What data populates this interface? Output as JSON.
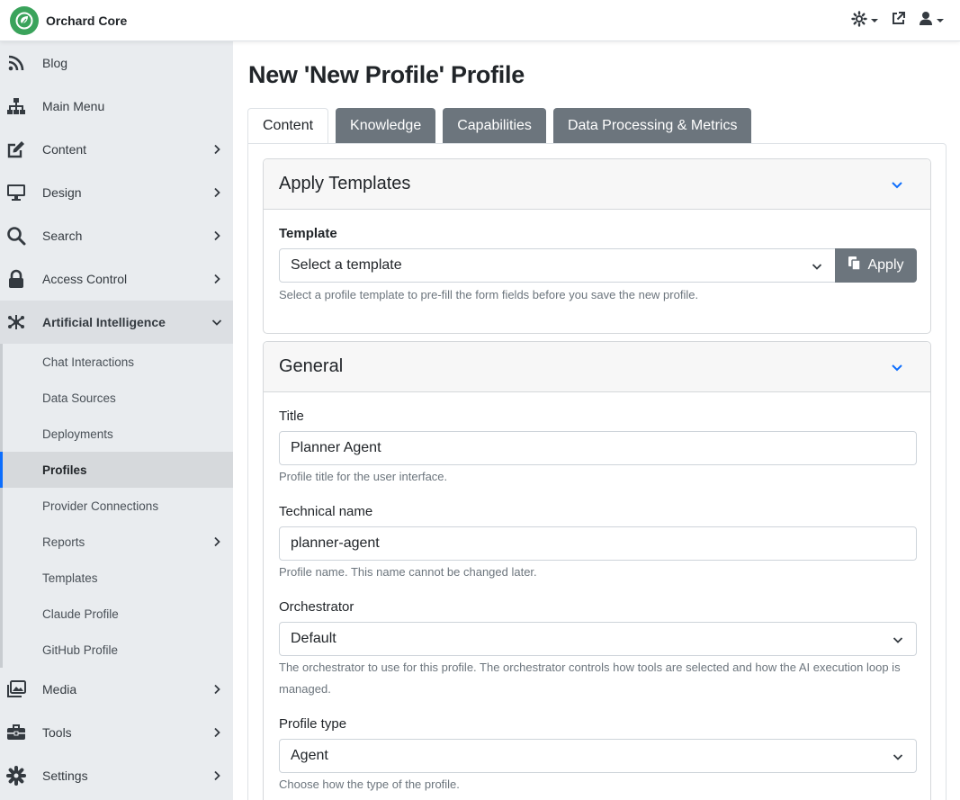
{
  "app": {
    "name": "Orchard Core"
  },
  "colors": {
    "brand": "#3aa35b",
    "accent": "#0d6efd",
    "tab_inactive": "#6c757d"
  },
  "topbar": {
    "icons": [
      "theme-settings-icon",
      "external-link-icon",
      "user-icon"
    ]
  },
  "sidebar": {
    "items": [
      {
        "label": "Blog",
        "icon": "rss-icon",
        "has_children": false
      },
      {
        "label": "Main Menu",
        "icon": "sitemap-icon",
        "has_children": false
      },
      {
        "label": "Content",
        "icon": "edit-icon",
        "has_children": true
      },
      {
        "label": "Design",
        "icon": "monitor-icon",
        "has_children": true
      },
      {
        "label": "Search",
        "icon": "search-icon",
        "has_children": true
      },
      {
        "label": "Access Control",
        "icon": "lock-icon",
        "has_children": true
      },
      {
        "label": "Artificial Intelligence",
        "icon": "ai-network-icon",
        "has_children": true,
        "expanded": true
      },
      {
        "label": "Media",
        "icon": "images-icon",
        "has_children": true
      },
      {
        "label": "Tools",
        "icon": "toolbox-icon",
        "has_children": true
      },
      {
        "label": "Settings",
        "icon": "gear-icon",
        "has_children": true
      }
    ],
    "ai_submenu": [
      {
        "label": "Chat Interactions",
        "has_children": false
      },
      {
        "label": "Data Sources",
        "has_children": false
      },
      {
        "label": "Deployments",
        "has_children": false
      },
      {
        "label": "Profiles",
        "has_children": false,
        "active": true
      },
      {
        "label": "Provider Connections",
        "has_children": false
      },
      {
        "label": "Reports",
        "has_children": true
      },
      {
        "label": "Templates",
        "has_children": false
      },
      {
        "label": "Claude Profile",
        "has_children": false
      },
      {
        "label": "GitHub Profile",
        "has_children": false
      }
    ]
  },
  "main": {
    "title": "New 'New Profile' Profile",
    "tabs": [
      {
        "label": "Content",
        "active": true
      },
      {
        "label": "Knowledge"
      },
      {
        "label": "Capabilities"
      },
      {
        "label": "Data Processing & Metrics"
      }
    ],
    "apply_templates": {
      "heading": "Apply Templates",
      "template_label": "Template",
      "template_value": "Select a template",
      "apply_label": "Apply",
      "help": "Select a profile template to pre-fill the form fields before you save the new profile."
    },
    "general": {
      "heading": "General",
      "title_label": "Title",
      "title_value": "Planner Agent",
      "title_help": "Profile title for the user interface.",
      "tech_label": "Technical name",
      "tech_value": "planner-agent",
      "tech_help": "Profile name. This name cannot be changed later.",
      "orch_label": "Orchestrator",
      "orch_value": "Default",
      "orch_help": "The orchestrator to use for this profile. The orchestrator controls how tools are selected and how the AI execution loop is managed.",
      "type_label": "Profile type",
      "type_value": "Agent",
      "type_help": "Choose how the type of the profile."
    }
  }
}
